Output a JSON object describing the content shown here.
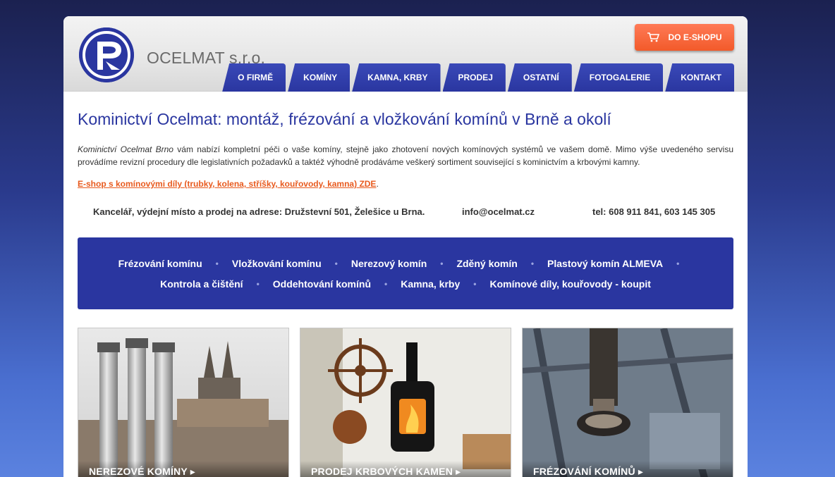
{
  "header": {
    "brand": "OCELMAT s.r.o.",
    "eshop_button": "DO E-SHOPU",
    "logo_icon": "ocelmat-logo",
    "cart_icon": "cart-icon"
  },
  "nav": {
    "items": [
      {
        "label": "O FIRMĚ"
      },
      {
        "label": "KOMÍNY"
      },
      {
        "label": "KAMNA, KRBY"
      },
      {
        "label": "PRODEJ"
      },
      {
        "label": "OSTATNÍ"
      },
      {
        "label": "FOTOGALERIE"
      },
      {
        "label": "KONTAKT"
      }
    ]
  },
  "main": {
    "title": "Kominictví Ocelmat: montáž, frézování a vložkování komínů v Brně a okolí",
    "intro_em": "Kominictví Ocelmat Brno",
    "intro_rest": " vám nabízí kompletní péči o vaše komíny, stejně jako zhotovení nových komínových systémů ve vašem domě.  Mimo výše uvedeného servisu provádíme revizní procedury dle legislativních požadavků a taktéž výhodně prodáváme veškerý sortiment související s kominictvím a krbovými kamny.",
    "eshop_link": "E-shop s komínovými díly (trubky, kolena, stříšky, kouřovody, kamna) ZDE",
    "eshop_link_suffix": "."
  },
  "contact": {
    "address": "Kancelář, výdejní místo a prodej na adrese: Družstevní 501, Želešice u Brna.",
    "email": "info@ocelmat.cz",
    "phone": "tel: 608 911 841,  603 145 305"
  },
  "services": {
    "row1": [
      "Frézování komínu",
      "Vložkování komínu",
      "Nerezový komín",
      "Zděný komín",
      "Plastový komín ALMEVA"
    ],
    "row2": [
      "Kontrola a čištění",
      "Oddehtování komínů",
      "Kamna, krby",
      "Komínové díly, kouřovody - koupit"
    ],
    "separator": "•"
  },
  "tiles": [
    {
      "caption": "NEREZOVÉ KOMÍNY  ▸"
    },
    {
      "caption": "PRODEJ KRBOVÝCH KAMEN  ▸"
    },
    {
      "caption": "FRÉZOVÁNÍ KOMÍNŮ  ▸"
    }
  ],
  "colors": {
    "brand_blue": "#2a36a0",
    "accent_orange": "#f25a2a",
    "link_orange": "#e85a1e"
  }
}
